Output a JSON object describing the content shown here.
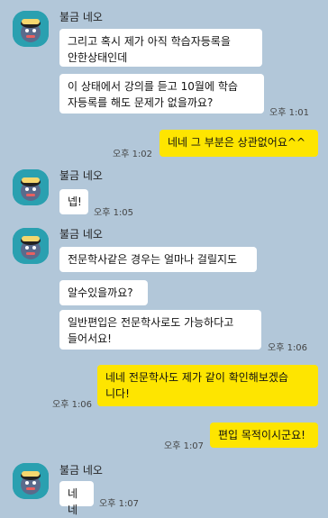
{
  "groups": [
    {
      "sender": "불금 네오",
      "messages": [
        {
          "text": "그리고 혹시 제가 아직 학습자등록을\n안한상태인데"
        },
        {
          "text": "이 상태에서 강의를 듣고 10월에 학습\n자등록를 해도 문제가 없을까요?",
          "time": "오후 1:01"
        }
      ]
    },
    {
      "sender": "불금 네오",
      "messages": [
        {
          "text": "넵!",
          "time": "오후 1:05"
        }
      ]
    },
    {
      "sender": "불금 네오",
      "messages": [
        {
          "text": "전문학사같은 경우는 얼마나 걸릴지도"
        },
        {
          "text": "알수있을까요?"
        },
        {
          "text": "일반편입은 전문학사로도 가능하다고\n들어서요!",
          "time": "오후 1:06"
        }
      ]
    },
    {
      "sender": "불금 네오",
      "messages": [
        {
          "text": "네네",
          "time": "오후 1:07"
        }
      ]
    }
  ],
  "outgoing": [
    {
      "text": "네네 그 부분은 상관없어요^^",
      "time": "오후 1:02"
    },
    {
      "text": "네네 전문학사도 제가 같이 확인해보겠습\n니다!",
      "time": "오후 1:06"
    },
    {
      "text": "편입 목적이시군요!",
      "time": "오후 1:07"
    }
  ],
  "colors": {
    "background": "#b2c7d9",
    "incoming": "#ffffff",
    "outgoing": "#fee500",
    "avatar": "#2aa0b0"
  },
  "avatar_icon": "character-avatar-icon"
}
